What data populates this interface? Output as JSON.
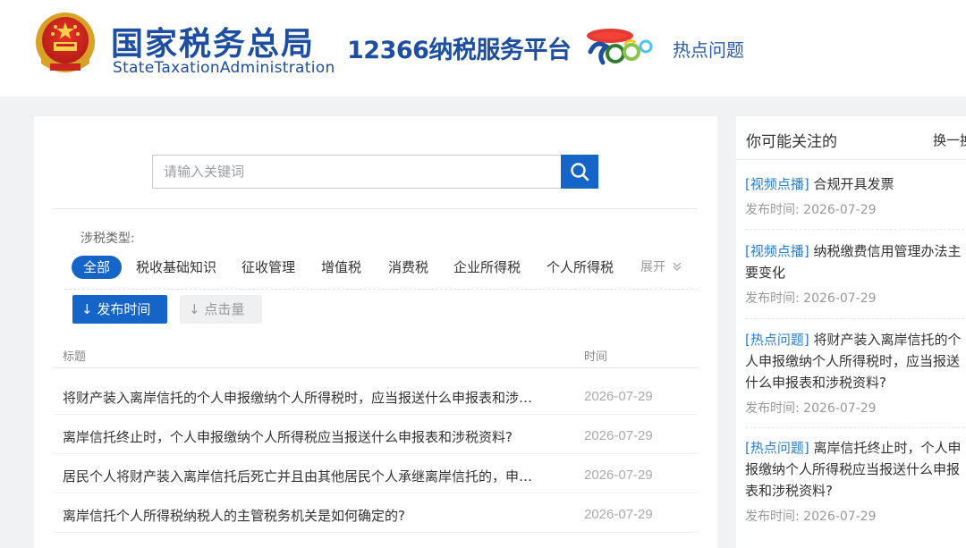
{
  "header": {
    "brand_cn": "国家税务总局",
    "brand_en": "StateTaxationAdministration",
    "service_title": "12366纳税服务平台",
    "hot_link": "热点问题"
  },
  "search": {
    "placeholder": "请输入关键词"
  },
  "filter": {
    "label": "涉税类型:",
    "chips": [
      "全部",
      "税收基础知识",
      "征收管理",
      "增值税",
      "消费税",
      "企业所得税",
      "个人所得税"
    ],
    "expand_label": "展开"
  },
  "sort": {
    "active_label": "发布时间",
    "inactive_label": "点击量"
  },
  "table": {
    "col_title": "标题",
    "col_time": "时间",
    "rows": [
      {
        "title": "将财产装入离岸信托的个人申报缴纳个人所得税时，应当报送什么申报表和涉…",
        "date": "2026-07-29"
      },
      {
        "title": "离岸信托终止时，个人申报缴纳个人所得税应当报送什么申报表和涉税资料?",
        "date": "2026-07-29"
      },
      {
        "title": "居民个人将财产装入离岸信托后死亡并且由其他居民个人承继离岸信托的，申…",
        "date": "2026-07-29"
      },
      {
        "title": "离岸信托个人所得税纳税人的主管税务机关是如何确定的?",
        "date": "2026-07-29"
      }
    ]
  },
  "side": {
    "title": "你可能关注的",
    "swap_label": "换一换",
    "date_prefix": "发布时间:",
    "items": [
      {
        "tag": "[视频点播]",
        "text": "合规开具发票",
        "date": "2026-07-29"
      },
      {
        "tag": "[视频点播]",
        "text": "纳税缴费信用管理办法主要变化",
        "date": "2026-07-29"
      },
      {
        "tag": "[热点问题]",
        "text": "将财产装入离岸信托的个人申报缴纳个人所得税时，应当报送什么申报表和涉税资料?",
        "date": "2026-07-29"
      },
      {
        "tag": "[热点问题]",
        "text": "离岸信托终止时，个人申报缴纳个人所得税应当报送什么申报表和涉税资料?",
        "date": "2026-07-29"
      }
    ]
  },
  "colors": {
    "brand_blue": "#1d4ea2",
    "primary": "#1565c8",
    "tag_blue": "#2a7fd1"
  }
}
